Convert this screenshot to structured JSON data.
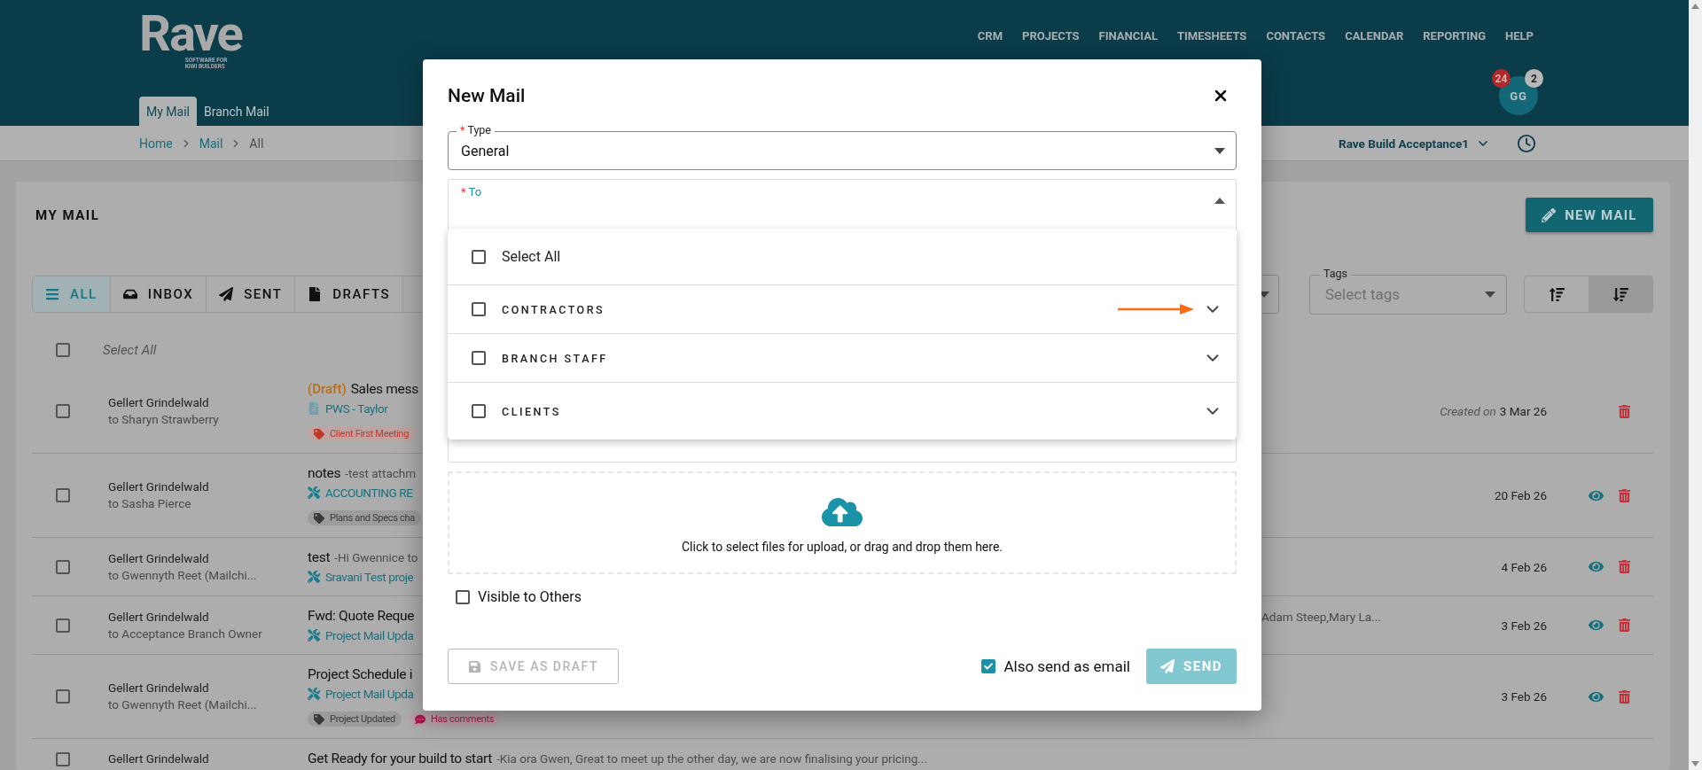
{
  "header": {
    "logo": {
      "name": "Rave",
      "tagline": [
        "SOFTWARE FOR",
        "KIWI BUILDERS"
      ]
    },
    "nav": [
      "CRM",
      "PROJECTS",
      "FINANCIAL",
      "TIMESHEETS",
      "CONTACTS",
      "CALENDAR",
      "REPORTING",
      "HELP"
    ],
    "tabs": [
      {
        "label": "My Mail",
        "selected": true
      },
      {
        "label": "Branch Mail",
        "selected": false
      }
    ],
    "user": {
      "initials": "GG",
      "badges": [
        {
          "count": "24",
          "color": "#b3262a"
        },
        {
          "count": "2",
          "color": "#b8b8b8"
        }
      ]
    }
  },
  "breadcrumb": {
    "items": [
      "Home",
      "Mail",
      "All"
    ],
    "company": "Rave Build Acceptance1"
  },
  "page": {
    "title": "MY MAIL",
    "new_button": "NEW MAIL",
    "filters": [
      {
        "label": "ALL",
        "kind": "all",
        "selected": true
      },
      {
        "label": "INBOX",
        "kind": "inbox",
        "selected": false
      },
      {
        "label": "SENT",
        "kind": "sent",
        "selected": false
      },
      {
        "label": "DRAFTS",
        "kind": "drafts",
        "selected": false
      }
    ],
    "tags_filter": {
      "label": "Tags",
      "placeholder": "Select tags"
    },
    "sort": [
      {
        "kind": "ascending",
        "selected": false
      },
      {
        "kind": "descending",
        "selected": true
      }
    ],
    "select_all": {
      "label": "Select All",
      "checked": false
    },
    "mails": [
      {
        "checked": false,
        "sender": "Gellert Grindelwald",
        "recipient": "to Sharyn Strawberry",
        "draft_label": "(Draft)",
        "subject": "Sales mess",
        "project": {
          "kind": "document",
          "name": "PWS - Taylor"
        },
        "tags": [
          {
            "kind": "tag",
            "label": "Client First Meeting",
            "color": "#c0392b"
          }
        ],
        "created_label": "Created on",
        "date": "3 Mar 26",
        "viewable": false,
        "deletable": true
      },
      {
        "checked": false,
        "sender": "Gellert Grindelwald",
        "recipient": "to Sasha Pierce",
        "subject": "notes",
        "preview": "-test attachm",
        "project": {
          "kind": "tools",
          "name": "ACCOUNTING RE"
        },
        "tags": [
          {
            "kind": "tag",
            "label": "Plans and Specs cha",
            "color": "#3a3a3a"
          }
        ],
        "date": "20 Feb 26",
        "viewable": true,
        "deletable": true
      },
      {
        "checked": false,
        "sender": "Gellert Grindelwald",
        "recipient": "to Gwennyth Reet (Mailchi...",
        "subject": "test",
        "preview": "-Hi Gwennice to",
        "project": {
          "kind": "tools",
          "name": "Sravani Test proje"
        },
        "date": "4 Feb 26",
        "viewable": true,
        "deletable": true
      },
      {
        "checked": false,
        "sender": "Gellert Grindelwald",
        "recipient": "to Acceptance Branch Owner",
        "subject": "Fwd: Quote Reque",
        "project": {
          "kind": "tools",
          "name": "Project Mail Upda"
        },
        "recipients": "Adam Steep,Mary La...",
        "date": "3 Feb 26",
        "viewable": true,
        "deletable": true
      },
      {
        "checked": false,
        "sender": "Gellert Grindelwald",
        "recipient": "to Gwennyth Reet (Mailchi...",
        "subject": "Project Schedule i",
        "project": {
          "kind": "tools",
          "name": "Project Mail Upda"
        },
        "tags": [
          {
            "kind": "tag",
            "label": "Project Updated",
            "color": "#3a3a3a"
          },
          {
            "kind": "comment",
            "label": "Has comments",
            "color": "#b0174f"
          }
        ],
        "date": "3 Feb 26",
        "viewable": true,
        "deletable": true
      },
      {
        "checked": false,
        "sender": "Gellert Grindelwald",
        "subject": "Get Ready for your build to start",
        "preview": "-Kia ora Gwen, Great to meet up the other day, we are now finalising your pricing...",
        "viewable": false,
        "deletable": false
      }
    ]
  },
  "dialog": {
    "title": "New Mail",
    "type": {
      "required_mark": "*",
      "label": "Type",
      "value": "General"
    },
    "to": {
      "required_mark": "*",
      "label": "To",
      "expanded": true,
      "options": [
        {
          "kind": "all",
          "label": "Select All",
          "checked": false
        },
        {
          "kind": "group",
          "label": "CONTRACTORS",
          "checked": false,
          "expanded": false,
          "pointer": true
        },
        {
          "kind": "group",
          "label": "BRANCH STAFF",
          "checked": false,
          "expanded": false,
          "pointer": false
        },
        {
          "kind": "group",
          "label": "CLIENTS",
          "checked": false,
          "expanded": false,
          "pointer": false
        }
      ]
    },
    "upload": "Click to select files for upload, or drag and drop them here.",
    "visible_to_others": {
      "label": "Visible to Others",
      "checked": false
    },
    "save_draft": {
      "label": "SAVE AS DRAFT",
      "disabled": true
    },
    "also_email": {
      "label": "Also send as email",
      "checked": true
    },
    "send": {
      "label": "SEND",
      "disabled": true
    }
  }
}
